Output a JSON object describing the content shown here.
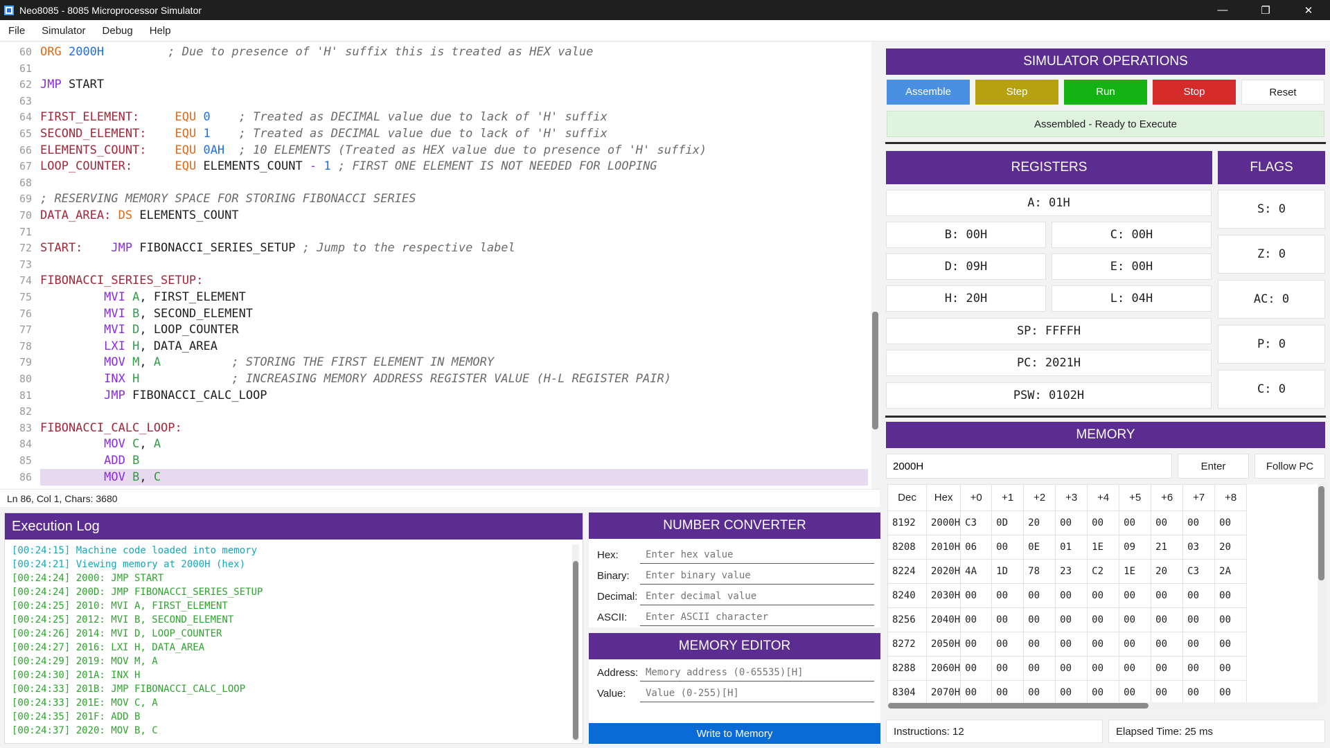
{
  "window": {
    "title": "Neo8085 - 8085 Microprocessor Simulator",
    "controls": {
      "minimize": "—",
      "maximize": "❐",
      "close": "✕"
    }
  },
  "menu": [
    "File",
    "Simulator",
    "Debug",
    "Help"
  ],
  "editor": {
    "lines": [
      {
        "n": "60",
        "tokens": [
          [
            "dir",
            "ORG"
          ],
          [
            "id",
            " "
          ],
          [
            "num",
            "2000H"
          ],
          [
            "id",
            "         "
          ],
          [
            "com",
            "; Due to presence of 'H' suffix this is treated as HEX value"
          ]
        ]
      },
      {
        "n": "61",
        "tokens": []
      },
      {
        "n": "62",
        "tokens": [
          [
            "kw",
            "JMP"
          ],
          [
            "id",
            " START"
          ]
        ]
      },
      {
        "n": "63",
        "tokens": []
      },
      {
        "n": "64",
        "tokens": [
          [
            "lbl",
            "FIRST_ELEMENT:"
          ],
          [
            "id",
            "     "
          ],
          [
            "dir",
            "EQU"
          ],
          [
            "id",
            " "
          ],
          [
            "num",
            "0"
          ],
          [
            "id",
            "    "
          ],
          [
            "com",
            "; Treated as DECIMAL value due to lack of 'H' suffix"
          ]
        ]
      },
      {
        "n": "65",
        "tokens": [
          [
            "lbl",
            "SECOND_ELEMENT:"
          ],
          [
            "id",
            "    "
          ],
          [
            "dir",
            "EQU"
          ],
          [
            "id",
            " "
          ],
          [
            "num",
            "1"
          ],
          [
            "id",
            "    "
          ],
          [
            "com",
            "; Treated as DECIMAL value due to lack of 'H' suffix"
          ]
        ]
      },
      {
        "n": "66",
        "tokens": [
          [
            "lbl",
            "ELEMENTS_COUNT:"
          ],
          [
            "id",
            "    "
          ],
          [
            "dir",
            "EQU"
          ],
          [
            "id",
            " "
          ],
          [
            "num",
            "0AH"
          ],
          [
            "id",
            "  "
          ],
          [
            "com",
            "; 10 ELEMENTS (Treated as HEX value due to presence of 'H' suffix)"
          ]
        ]
      },
      {
        "n": "67",
        "tokens": [
          [
            "lbl",
            "LOOP_COUNTER:"
          ],
          [
            "id",
            "      "
          ],
          [
            "dir",
            "EQU"
          ],
          [
            "id",
            " ELEMENTS_COUNT "
          ],
          [
            "op",
            "-"
          ],
          [
            "id",
            " "
          ],
          [
            "num",
            "1"
          ],
          [
            "id",
            " "
          ],
          [
            "com",
            "; FIRST ONE ELEMENT IS NOT NEEDED FOR LOOPING"
          ]
        ]
      },
      {
        "n": "68",
        "tokens": []
      },
      {
        "n": "69",
        "tokens": [
          [
            "com",
            "; RESERVING MEMORY SPACE FOR STORING FIBONACCI SERIES"
          ]
        ]
      },
      {
        "n": "70",
        "tokens": [
          [
            "lbl",
            "DATA_AREA:"
          ],
          [
            "id",
            " "
          ],
          [
            "dir",
            "DS"
          ],
          [
            "id",
            " ELEMENTS_COUNT"
          ]
        ]
      },
      {
        "n": "71",
        "tokens": []
      },
      {
        "n": "72",
        "tokens": [
          [
            "lbl",
            "START:"
          ],
          [
            "id",
            "    "
          ],
          [
            "kw",
            "JMP"
          ],
          [
            "id",
            " FIBONACCI_SERIES_SETUP "
          ],
          [
            "com",
            "; Jump to the respective label"
          ]
        ]
      },
      {
        "n": "73",
        "tokens": []
      },
      {
        "n": "74",
        "tokens": [
          [
            "lbl",
            "FIBONACCI_SERIES_SETUP:"
          ]
        ]
      },
      {
        "n": "75",
        "tokens": [
          [
            "id",
            "         "
          ],
          [
            "kw",
            "MVI"
          ],
          [
            "id",
            " "
          ],
          [
            "reg",
            "A"
          ],
          [
            "id",
            ", FIRST_ELEMENT"
          ]
        ]
      },
      {
        "n": "76",
        "tokens": [
          [
            "id",
            "         "
          ],
          [
            "kw",
            "MVI"
          ],
          [
            "id",
            " "
          ],
          [
            "reg",
            "B"
          ],
          [
            "id",
            ", SECOND_ELEMENT"
          ]
        ]
      },
      {
        "n": "77",
        "tokens": [
          [
            "id",
            "         "
          ],
          [
            "kw",
            "MVI"
          ],
          [
            "id",
            " "
          ],
          [
            "reg",
            "D"
          ],
          [
            "id",
            ", LOOP_COUNTER"
          ]
        ]
      },
      {
        "n": "78",
        "tokens": [
          [
            "id",
            "         "
          ],
          [
            "kw",
            "LXI"
          ],
          [
            "id",
            " "
          ],
          [
            "reg",
            "H"
          ],
          [
            "id",
            ", DATA_AREA"
          ]
        ]
      },
      {
        "n": "79",
        "tokens": [
          [
            "id",
            "         "
          ],
          [
            "kw",
            "MOV"
          ],
          [
            "id",
            " "
          ],
          [
            "reg",
            "M"
          ],
          [
            "id",
            ", "
          ],
          [
            "reg",
            "A"
          ],
          [
            "id",
            "          "
          ],
          [
            "com",
            "; STORING THE FIRST ELEMENT IN MEMORY"
          ]
        ]
      },
      {
        "n": "80",
        "tokens": [
          [
            "id",
            "         "
          ],
          [
            "kw",
            "INX"
          ],
          [
            "id",
            " "
          ],
          [
            "reg",
            "H"
          ],
          [
            "id",
            "             "
          ],
          [
            "com",
            "; INCREASING MEMORY ADDRESS REGISTER VALUE (H-L REGISTER PAIR)"
          ]
        ]
      },
      {
        "n": "81",
        "tokens": [
          [
            "id",
            "         "
          ],
          [
            "kw",
            "JMP"
          ],
          [
            "id",
            " FIBONACCI_CALC_LOOP"
          ]
        ]
      },
      {
        "n": "82",
        "tokens": []
      },
      {
        "n": "83",
        "tokens": [
          [
            "lbl",
            "FIBONACCI_CALC_LOOP:"
          ]
        ]
      },
      {
        "n": "84",
        "tokens": [
          [
            "id",
            "         "
          ],
          [
            "kw",
            "MOV"
          ],
          [
            "id",
            " "
          ],
          [
            "reg",
            "C"
          ],
          [
            "id",
            ", "
          ],
          [
            "reg",
            "A"
          ]
        ]
      },
      {
        "n": "85",
        "tokens": [
          [
            "id",
            "         "
          ],
          [
            "kw",
            "ADD"
          ],
          [
            "id",
            " "
          ],
          [
            "reg",
            "B"
          ]
        ]
      },
      {
        "n": "86",
        "tokens": [
          [
            "id",
            "         "
          ],
          [
            "kw",
            "MOV"
          ],
          [
            "id",
            " "
          ],
          [
            "reg",
            "B"
          ],
          [
            "id",
            ", "
          ],
          [
            "reg",
            "C"
          ]
        ],
        "highlight": true
      }
    ],
    "status": "Ln 86, Col 1, Chars: 3680"
  },
  "exec_log": {
    "title": "Execution Log",
    "entries": [
      {
        "t": "[00:24:15] Machine code loaded into memory",
        "c": "cyan"
      },
      {
        "t": "[00:24:21] Viewing memory at 2000H (hex)",
        "c": "cyan"
      },
      {
        "t": "[00:24:24] 2000: JMP START",
        "c": "green"
      },
      {
        "t": "[00:24:24] 200D: JMP FIBONACCI_SERIES_SETUP",
        "c": "green"
      },
      {
        "t": "[00:24:25] 2010: MVI A, FIRST_ELEMENT",
        "c": "green"
      },
      {
        "t": "[00:24:25] 2012: MVI B, SECOND_ELEMENT",
        "c": "green"
      },
      {
        "t": "[00:24:26] 2014: MVI D, LOOP_COUNTER",
        "c": "green"
      },
      {
        "t": "[00:24:27] 2016: LXI H, DATA_AREA",
        "c": "green"
      },
      {
        "t": "[00:24:29] 2019: MOV M, A",
        "c": "green"
      },
      {
        "t": "[00:24:30] 201A: INX H",
        "c": "green"
      },
      {
        "t": "[00:24:33] 201B: JMP FIBONACCI_CALC_LOOP",
        "c": "green"
      },
      {
        "t": "[00:24:33] 201E: MOV C, A",
        "c": "green"
      },
      {
        "t": "[00:24:35] 201F: ADD B",
        "c": "green"
      },
      {
        "t": "[00:24:37] 2020: MOV B, C",
        "c": "green"
      }
    ]
  },
  "number_converter": {
    "title": "NUMBER CONVERTER",
    "fields": [
      {
        "label": "Hex:",
        "placeholder": "Enter hex value"
      },
      {
        "label": "Binary:",
        "placeholder": "Enter binary value"
      },
      {
        "label": "Decimal:",
        "placeholder": "Enter decimal value"
      },
      {
        "label": "ASCII:",
        "placeholder": "Enter ASCII character"
      }
    ]
  },
  "memory_editor": {
    "title": "MEMORY EDITOR",
    "address_label": "Address:",
    "address_placeholder": "Memory address (0-65535)[H]",
    "value_label": "Value:",
    "value_placeholder": "Value (0-255)[H]",
    "write_button": "Write to Memory"
  },
  "sim_ops": {
    "title": "SIMULATOR OPERATIONS",
    "buttons": {
      "assemble": "Assemble",
      "step": "Step",
      "run": "Run",
      "stop": "Stop",
      "reset": "Reset"
    },
    "status": "Assembled - Ready to Execute"
  },
  "registers": {
    "title": "REGISTERS",
    "A": "A: 01H",
    "B": "B: 00H",
    "C": "C: 00H",
    "D": "D: 09H",
    "E": "E: 00H",
    "H": "H: 20H",
    "L": "L: 04H",
    "SP": "SP: FFFFH",
    "PC": "PC: 2021H",
    "PSW": "PSW: 0102H"
  },
  "flags": {
    "title": "FLAGS",
    "S": "S: 0",
    "Z": "Z: 0",
    "AC": "AC: 0",
    "P": "P: 0",
    "C": "C: 0"
  },
  "memory": {
    "title": "MEMORY",
    "address_value": "2000H",
    "enter_button": "Enter",
    "follow_button": "Follow PC",
    "columns": [
      "Dec",
      "Hex",
      "+0",
      "+1",
      "+2",
      "+3",
      "+4",
      "+5",
      "+6",
      "+7",
      "+8"
    ],
    "rows": [
      [
        "8192",
        "2000H",
        "C3",
        "0D",
        "20",
        "00",
        "00",
        "00",
        "00",
        "00",
        "00"
      ],
      [
        "8208",
        "2010H",
        "06",
        "00",
        "0E",
        "01",
        "1E",
        "09",
        "21",
        "03",
        "20"
      ],
      [
        "8224",
        "2020H",
        "4A",
        "1D",
        "78",
        "23",
        "C2",
        "1E",
        "20",
        "C3",
        "2A"
      ],
      [
        "8240",
        "2030H",
        "00",
        "00",
        "00",
        "00",
        "00",
        "00",
        "00",
        "00",
        "00"
      ],
      [
        "8256",
        "2040H",
        "00",
        "00",
        "00",
        "00",
        "00",
        "00",
        "00",
        "00",
        "00"
      ],
      [
        "8272",
        "2050H",
        "00",
        "00",
        "00",
        "00",
        "00",
        "00",
        "00",
        "00",
        "00"
      ],
      [
        "8288",
        "2060H",
        "00",
        "00",
        "00",
        "00",
        "00",
        "00",
        "00",
        "00",
        "00"
      ],
      [
        "8304",
        "2070H",
        "00",
        "00",
        "00",
        "00",
        "00",
        "00",
        "00",
        "00",
        "00"
      ]
    ]
  },
  "footer": {
    "instructions": "Instructions: 12",
    "elapsed": "Elapsed Time: 25 ms"
  },
  "colors": {
    "accent_purple": "#5c2d91",
    "assemble": "#4a90e2",
    "step": "#b5a20e",
    "run": "#12b312",
    "stop": "#d62b2b",
    "write": "#0a6ad6",
    "status_green_bg": "#dff3df"
  }
}
